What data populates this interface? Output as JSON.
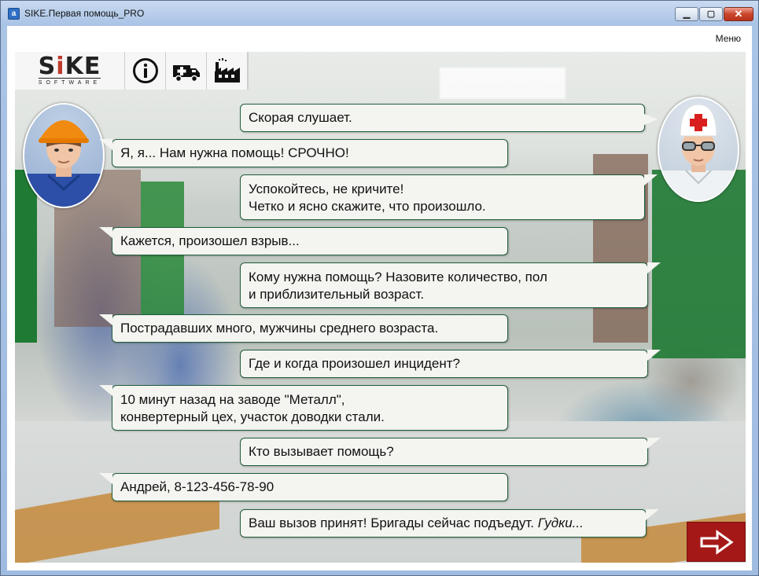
{
  "window": {
    "title": "SIKE.Первая помощь_PRO",
    "app_icon_letter": "a",
    "minimize_glyph": "▁",
    "maximize_glyph": "▢",
    "close_glyph": "✕"
  },
  "menu": {
    "label": "Меню"
  },
  "toolbar": {
    "logo_text_s": "S",
    "logo_text_i": "i",
    "logo_text_ke": "KE",
    "logo_sub": "SOFTWARE",
    "icons": [
      "info-icon",
      "ambulance-icon",
      "factory-icon"
    ]
  },
  "dialog": [
    {
      "speaker": "dispatcher",
      "lines": [
        "Скорая слушает."
      ]
    },
    {
      "speaker": "caller",
      "lines": [
        "Я, я... Нам нужна помощь! СРОЧНО!"
      ]
    },
    {
      "speaker": "dispatcher",
      "lines": [
        "Успокойтесь, не кричите!",
        "Четко и ясно скажите, что произошло."
      ]
    },
    {
      "speaker": "caller",
      "lines": [
        "Кажется, произошел взрыв..."
      ]
    },
    {
      "speaker": "dispatcher",
      "lines": [
        "Кому нужна помощь? Назовите количество, пол",
        "и приблизительный возраст."
      ]
    },
    {
      "speaker": "caller",
      "lines": [
        "Пострадавших много, мужчины среднего возраста."
      ]
    },
    {
      "speaker": "dispatcher",
      "lines": [
        "Где и когда произошел инцидент?"
      ]
    },
    {
      "speaker": "caller",
      "lines": [
        "10 минут назад на заводе \"Металл\",",
        "конвертерный цех, участок доводки стали."
      ]
    },
    {
      "speaker": "dispatcher",
      "lines": [
        "Кто вызывает помощь?"
      ]
    },
    {
      "speaker": "caller",
      "lines": [
        "Андрей, 8-123-456-78-90"
      ]
    },
    {
      "speaker": "dispatcher",
      "lines": [
        "Ваш вызов принят! Бригады сейчас подъедут."
      ],
      "italic_suffix": "Гудки..."
    }
  ],
  "next_button": {
    "icon": "arrow-right-icon"
  },
  "colors": {
    "bubble_border": "#1f5e3a",
    "next_button": "#a51818"
  }
}
